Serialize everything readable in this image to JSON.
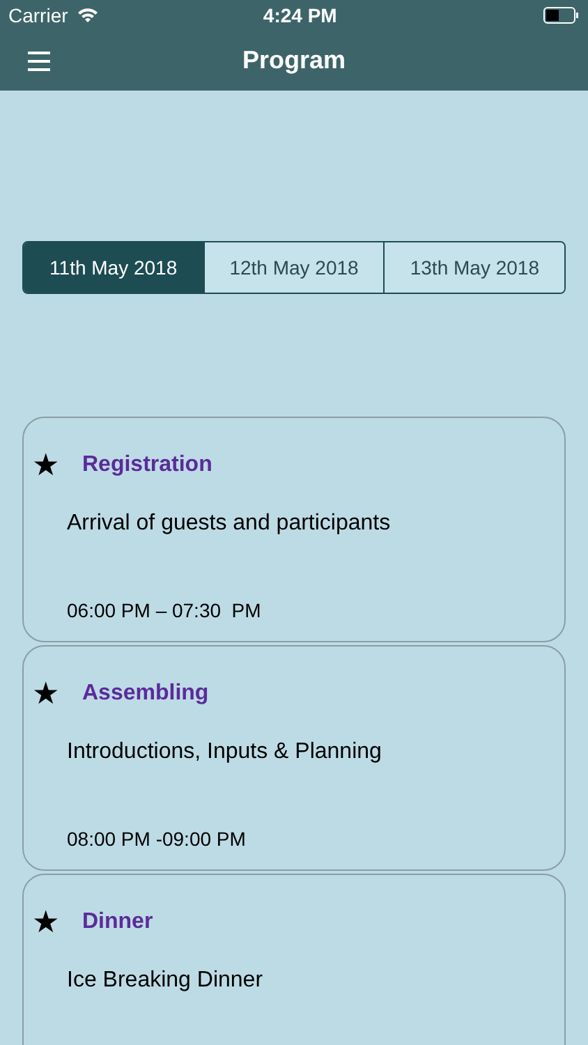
{
  "status_bar": {
    "carrier": "Carrier",
    "time": "4:24 PM"
  },
  "nav": {
    "title": "Program"
  },
  "tabs": [
    {
      "label": "11th May 2018",
      "selected": true
    },
    {
      "label": "12th May 2018",
      "selected": false
    },
    {
      "label": "13th May 2018",
      "selected": false
    }
  ],
  "events": [
    {
      "star": "★",
      "title": "Registration",
      "description": "Arrival of guests and participants",
      "time": "06:00 PM – 07:30  PM"
    },
    {
      "star": "★",
      "title": "Assembling",
      "description": "Introductions, Inputs & Planning",
      "time": "08:00 PM -09:00 PM"
    },
    {
      "star": "★",
      "title": "Dinner",
      "description": "Ice Breaking Dinner"
    }
  ]
}
